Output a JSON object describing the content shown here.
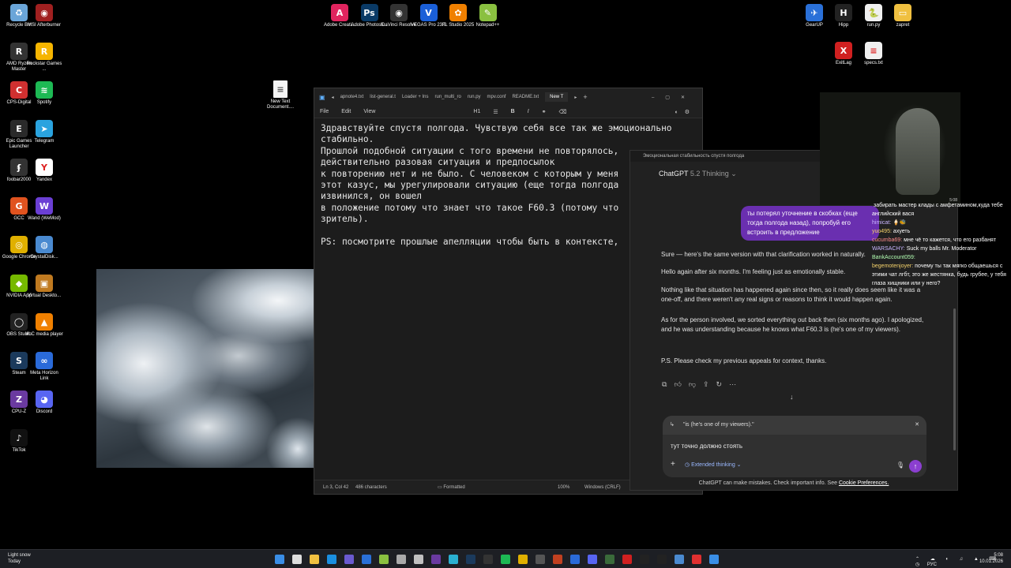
{
  "desktop": {
    "icons_left": [
      {
        "label": "Recycle Bin",
        "color": "#6aa5d8",
        "glyph": "♻"
      },
      {
        "label": "MSI Afterburner",
        "color": "#a02020",
        "glyph": "◉"
      },
      {
        "label": "AMD Ryzen Master",
        "color": "#333333",
        "glyph": "R"
      },
      {
        "label": "Rockstar Games ...",
        "color": "#f6b500",
        "glyph": "R"
      },
      {
        "label": "CPS-Digital",
        "color": "#d03030",
        "glyph": "C"
      },
      {
        "label": "Spotify",
        "color": "#1db954",
        "glyph": "≋"
      },
      {
        "label": "Epic Games Launcher",
        "color": "#2a2a2a",
        "glyph": "E"
      },
      {
        "label": "Telegram",
        "color": "#2aa3df",
        "glyph": "➤"
      },
      {
        "label": "foobar2000",
        "color": "#333333",
        "glyph": "ʄ"
      },
      {
        "label": "Yandex",
        "color": "#ffffff",
        "glyph": "Y"
      },
      {
        "label": "GCC",
        "color": "#e0531f",
        "glyph": "G"
      },
      {
        "label": "Wand (WeMod)",
        "color": "#6b3fd4",
        "glyph": "W"
      },
      {
        "label": "Google Chrome",
        "color": "#e0b000",
        "glyph": "◎"
      },
      {
        "label": "CrystalDisk...",
        "color": "#4a8ad0",
        "glyph": "◍"
      },
      {
        "label": "NVIDIA App",
        "color": "#76b900",
        "glyph": "◆"
      },
      {
        "label": "Virtual Deskto...",
        "color": "#c07a20",
        "glyph": "▣"
      },
      {
        "label": "OBS Studio",
        "color": "#222222",
        "glyph": "◯"
      },
      {
        "label": "VLC media player",
        "color": "#f08000",
        "glyph": "▲"
      },
      {
        "label": "Steam",
        "color": "#1b3a5c",
        "glyph": "S"
      },
      {
        "label": "Meta Horizon Link",
        "color": "#2a6ad8",
        "glyph": "∞"
      },
      {
        "label": "CPU-Z",
        "color": "#6a3aa0",
        "glyph": "Z"
      },
      {
        "label": "Discord",
        "color": "#5865f2",
        "glyph": "◕"
      },
      {
        "label": "TikTok",
        "color": "#111111",
        "glyph": "♪"
      }
    ],
    "icons_top": [
      {
        "label": "Adobe Creati...",
        "color": "#e0245e",
        "glyph": "A"
      },
      {
        "label": "Adobe Photosh...",
        "color": "#0a3a66",
        "glyph": "Ps"
      },
      {
        "label": "DaVinci Resolve",
        "color": "#333333",
        "glyph": "◉"
      },
      {
        "label": "VEGAS Pro 23.0",
        "color": "#1a5fd8",
        "glyph": "V"
      },
      {
        "label": "FL Studio 2025",
        "color": "#f08000",
        "glyph": "✿"
      },
      {
        "label": "Notepad++",
        "color": "#8ac040",
        "glyph": "✎"
      }
    ],
    "icons_right": [
      {
        "label": "GearUP",
        "color": "#2a70d8",
        "glyph": "✈"
      },
      {
        "label": "Hipp",
        "color": "#222222",
        "glyph": "H"
      },
      {
        "label": "run.py",
        "color": "#f0f0f0",
        "glyph": "🐍"
      },
      {
        "label": "zapret",
        "color": "#f0c040",
        "glyph": "▭"
      },
      {
        "label": "ExitLag",
        "color": "#d02020",
        "glyph": "X"
      },
      {
        "label": "specs.txt",
        "color": "#f0f0f0",
        "glyph": "≡"
      }
    ],
    "new_text_doc": "New Text Document...."
  },
  "notepad": {
    "tabs": [
      "apnote4.txt",
      "list-general.t",
      "Loader + Ins",
      "run_multi_ro",
      "run.py",
      "mpv.conf",
      "README.txt",
      "New T"
    ],
    "menu": [
      "File",
      "Edit",
      "View"
    ],
    "heading_select": "H1",
    "body": "Здравствуйте спустя полгода. Чувствую себя все так же эмоционально\nстабильно.\nПрошлой подобной ситуации с того времени не повторялось,\nдействительно разовая ситуация и предпосылок\nк повторению нет и не было. С человеком с которым у меня\nэтот казус, мы урегулировали ситуацию (еще тогда полгода\nизвинился, он вошел\nв положение потому что знает что такое F60.3 (потому что\nзритель).\n\nPS: посмотрите прошлые апелляции чтобы быть в контексте,",
    "status": {
      "position": "Ln 3, Col 42",
      "chars": "486 characters",
      "format": "Formatted",
      "zoom": "100%",
      "eol": "Windows (CRLF)"
    }
  },
  "chat": {
    "window_title": "Эмоциональная стабильность спустя полгода",
    "model": "ChatGPT",
    "model_version": "5.2 Thinking",
    "user_message": "ты потерял уточнение в скобках (еще тогда полгода назад), попробуй его встроить в предложение",
    "answer": [
      "Sure — here's the same version with that clarification worked in naturally.",
      "Hello again after six months. I'm feeling just as emotionally stable.",
      "Nothing like that situation has happened again since then, so it really does seem like it was a one-off, and there weren't any real signs or reasons to think it would happen again.",
      "As for the person involved, we sorted everything out back then (six months ago). I apologized, and he was understanding because he knows what F60.3 is (he's one of my viewers).",
      "P.S. Please check my previous appeals for context, thanks."
    ],
    "quote": "\"is (he's one of my viewers).\"",
    "input_text": "тут точно должно стоять",
    "mode": "Extended thinking",
    "disclaimer": "ChatGPT can make mistakes. Check important info. See",
    "disclaimer_link": "Cookie Preferences."
  },
  "stream_chat": [
    {
      "user": "",
      "text": "забирать мастер клады с амфетамином,куда тебе английский вася"
    },
    {
      "user": "himicat:",
      "text": "🍦🐝"
    },
    {
      "user": "yuo495:",
      "text": "ахуеть"
    },
    {
      "user": "cucumba69:",
      "text": "мне чё то кажется, что его разбанят"
    },
    {
      "user": "WARSACHY:",
      "text": "Suck my balls Mr. Moderator"
    },
    {
      "user": "BankAccount059:",
      "text": "⠀⠀"
    },
    {
      "user": "begemotenjoyer:",
      "text": "почему ты так мягко общаешься с этими чат лгбт, это же жестянка, будь грубее, у тебя глаза хищники или у него?"
    }
  ],
  "webcam_clock": "5:08",
  "taskbar": {
    "weather_title": "Light snow",
    "weather_sub": "Today",
    "lang": "РУС",
    "time": "5:08",
    "date": "10.01.2026"
  }
}
